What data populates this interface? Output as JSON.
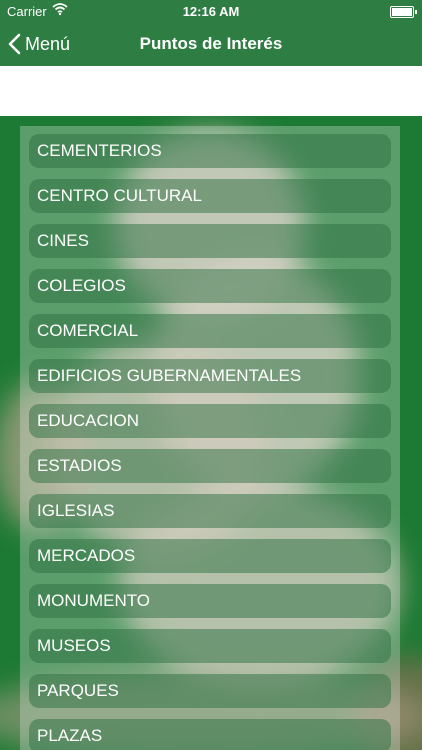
{
  "status_bar": {
    "carrier": "Carrier",
    "time": "12:16 AM",
    "battery_level": 1.0
  },
  "nav": {
    "back_label": "Menú",
    "title": "Puntos de Interés"
  },
  "categories": [
    "CEMENTERIOS",
    "CENTRO CULTURAL",
    "CINES",
    "COLEGIOS",
    "COMERCIAL",
    "EDIFICIOS GUBERNAMENTALES",
    "EDUCACION",
    "ESTADIOS",
    "IGLESIAS",
    "MERCADOS",
    "MONUMENTO",
    "MUSEOS",
    "PARQUES",
    "PLAZAS"
  ],
  "colors": {
    "primary_green": "#2e7d43",
    "background_green": "#1d7a34"
  }
}
